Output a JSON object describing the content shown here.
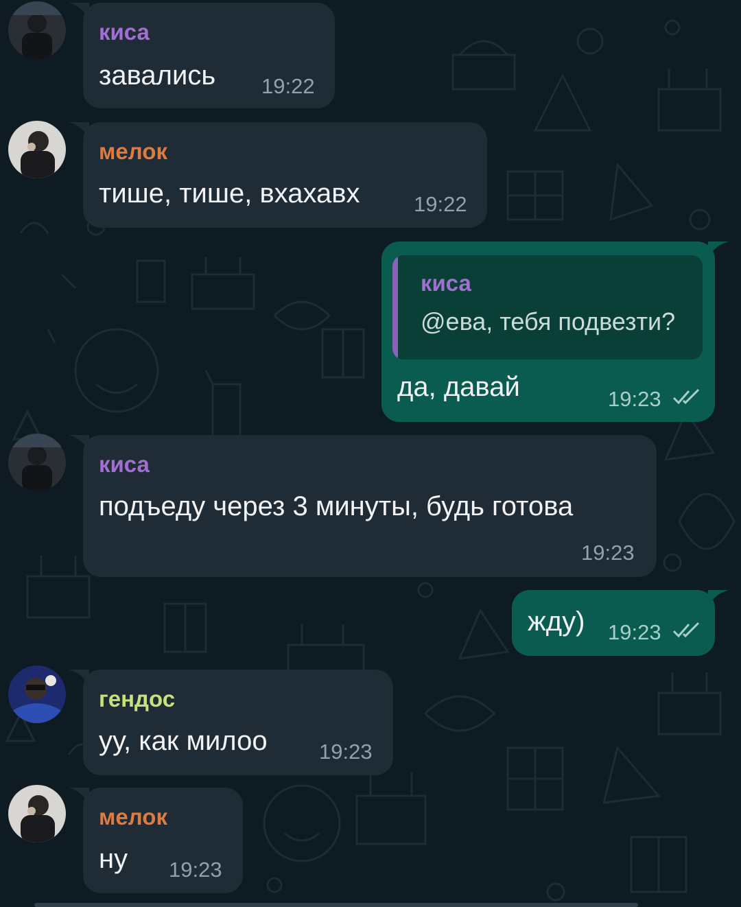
{
  "colors": {
    "background": "#0f1b23",
    "incoming_bubble": "#1f2b35",
    "outgoing_bubble": "#0b5c50",
    "name_kisa": "#a06fd0",
    "name_melok": "#df7b3e",
    "name_gendos": "#c6e07a",
    "read_checks": "#a7cfc8"
  },
  "messages": [
    {
      "id": "m1",
      "direction": "incoming",
      "sender": "киса",
      "text": "завались",
      "time": "19:22",
      "avatar": "avatar-kisa"
    },
    {
      "id": "m2",
      "direction": "incoming",
      "sender": "мелок",
      "text": "тише, тише, вхахавх",
      "time": "19:22",
      "avatar": "avatar-melok"
    },
    {
      "id": "m3",
      "direction": "outgoing",
      "reply_to": {
        "sender": "киса",
        "text": "@ева, тебя подвезти?"
      },
      "text": "да, давай",
      "time": "19:23",
      "status": "read"
    },
    {
      "id": "m4",
      "direction": "incoming",
      "sender": "киса",
      "text": "подъеду через 3 минуты, будь готова",
      "time": "19:23",
      "avatar": "avatar-kisa"
    },
    {
      "id": "m5",
      "direction": "outgoing",
      "text": "жду)",
      "time": "19:23",
      "status": "read"
    },
    {
      "id": "m6",
      "direction": "incoming",
      "sender": "гендос",
      "text": "уу, как милоо",
      "time": "19:23",
      "avatar": "avatar-gendos"
    },
    {
      "id": "m7",
      "direction": "incoming",
      "sender": "мелок",
      "text": "ну",
      "time": "19:23",
      "avatar": "avatar-melok"
    }
  ]
}
